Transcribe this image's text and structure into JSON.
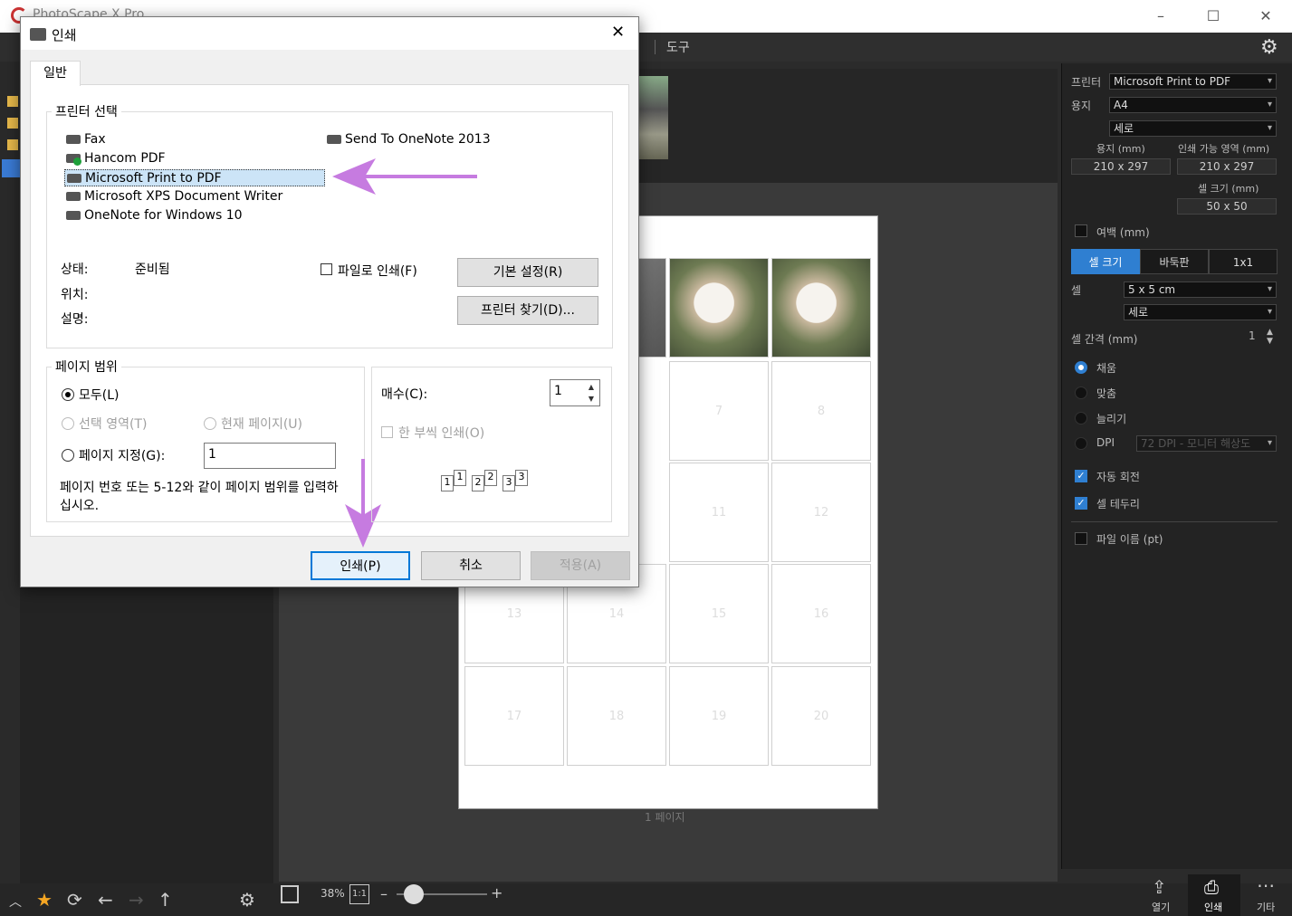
{
  "app": {
    "title": "PhotoScape X Pro",
    "menu_tools": "도구"
  },
  "dialog": {
    "title": "인쇄",
    "tab": "일반",
    "printer_group": "프린터 선택",
    "printers": [
      "Fax",
      "Hancom PDF",
      "Microsoft Print to PDF",
      "Microsoft XPS Document Writer",
      "OneNote for Windows 10",
      "Send To OneNote 2013"
    ],
    "status_label": "상태:",
    "status_value": "준비됨",
    "location_label": "위치:",
    "comment_label": "설명:",
    "print_to_file": "파일로 인쇄(F)",
    "preferences_btn": "기본 설정(R)",
    "find_printer_btn": "프린터 찾기(D)...",
    "page_range_group": "페이지 범위",
    "range_all": "모두(L)",
    "range_selection": "선택 영역(T)",
    "range_current": "현재 페이지(U)",
    "range_pages": "페이지 지정(G):",
    "range_pages_value": "1",
    "range_hint": "페이지 번호 또는 5-12와 같이 페이지 범위를 입력하십시오.",
    "copies_label": "매수(C):",
    "copies_value": "1",
    "collate": "한 부씩 인쇄(O)",
    "collate_icons": [
      "1",
      "1",
      "2",
      "2",
      "3",
      "3"
    ],
    "print_btn": "인쇄(P)",
    "cancel_btn": "취소",
    "apply_btn": "적용(A)"
  },
  "right_panel": {
    "printer_label": "프린터",
    "printer_value": "Microsoft Print to PDF",
    "paper_label": "용지",
    "paper_value": "A4",
    "orientation_value": "세로",
    "paper_size_label": "용지 (mm)",
    "paper_size_value": "210 x 297",
    "printable_label": "인쇄 가능 영역 (mm)",
    "printable_value": "210 x 297",
    "cell_size_label": "셀 크기 (mm)",
    "cell_size_value": "50 x 50",
    "margin_label": "여백 (mm)",
    "seg_cell": "셀 크기",
    "seg_grid": "바둑판",
    "seg_1x1": "1x1",
    "cell_label": "셀",
    "cell_value": "5 x 5 cm",
    "cell_orient": "세로",
    "cell_gap_label": "셀 간격 (mm)",
    "cell_gap_value": "1",
    "fill": "채움",
    "fit": "맞춤",
    "stretch": "늘리기",
    "dpi": "DPI",
    "dpi_value": "72 DPI - 모니터 해상도",
    "auto_rotate": "자동 회전",
    "cell_border": "셀 테두리",
    "file_name": "파일 이름 (pt)"
  },
  "canvas": {
    "page_label": "1 페이지",
    "cells": [
      "7",
      "8",
      "11",
      "12",
      "13",
      "14",
      "15",
      "16",
      "17",
      "18",
      "19",
      "20"
    ]
  },
  "bottom": {
    "zoom": "38%",
    "one_to_one": "1:1",
    "open": "열기",
    "print": "인쇄",
    "more": "기타"
  }
}
